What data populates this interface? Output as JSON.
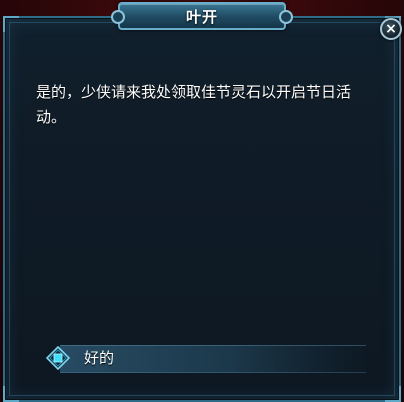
{
  "dialog": {
    "npc_name": "叶开",
    "message": "是的，少侠请来我处领取佳节灵石以开启节日活动。",
    "options": [
      {
        "label": "好的"
      }
    ],
    "close_label": "×"
  },
  "colors": {
    "panel_border": "#2d6b86",
    "panel_bg": "#0f1b26",
    "title_plate": "#1f4a62",
    "icon_cyan": "#3fe0ff",
    "text": "#ffffff"
  }
}
